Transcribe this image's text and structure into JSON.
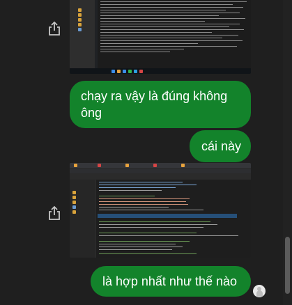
{
  "messages": [
    {
      "id": "b1",
      "text": "chạy ra vậy là đúng không ông"
    },
    {
      "id": "b2",
      "text": "cái này"
    },
    {
      "id": "b3",
      "text": "là hợp nhất như thế nào"
    }
  ],
  "colors": {
    "background": "#1f1f1f",
    "bubble": "#13832b",
    "bubble_text": "#ffffff",
    "icon": "#c7c7c7"
  },
  "icons": [
    "share-icon",
    "share-icon",
    "seen-avatar-icon"
  ]
}
